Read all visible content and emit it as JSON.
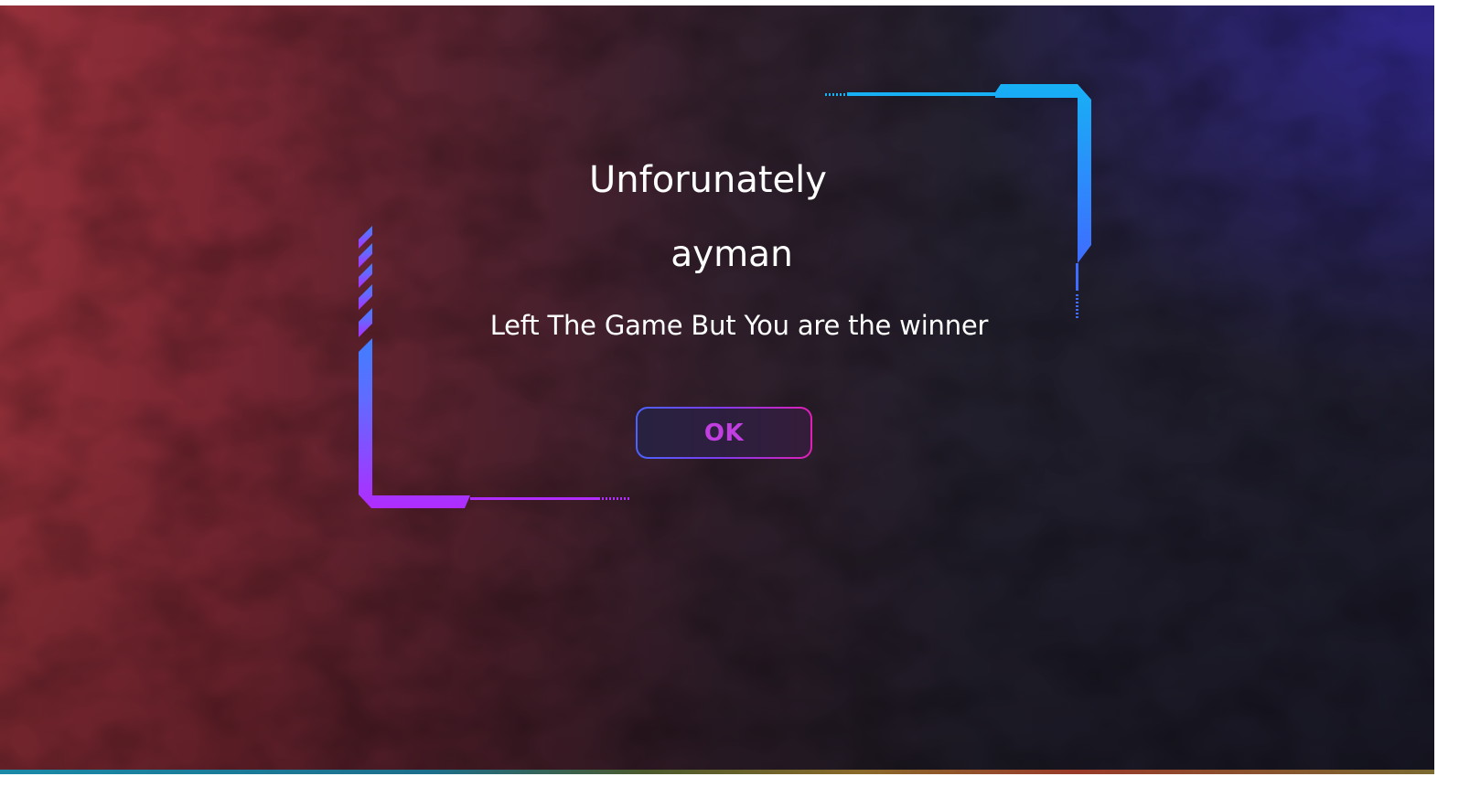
{
  "dialog": {
    "title": "Unforunately",
    "player_name": "ayman",
    "message": "Left The Game But You are the winner",
    "ok_label": "OK"
  },
  "colors": {
    "frame_left_top": "#3f7fff",
    "frame_left_bottom": "#b02cff",
    "frame_right_top": "#17b0f5",
    "frame_right_bottom": "#3f6cff",
    "ok_border_start": "#4a63ff",
    "ok_border_end": "#e01fb5",
    "ok_text": "#c13ee0",
    "text": "#ffffff"
  }
}
